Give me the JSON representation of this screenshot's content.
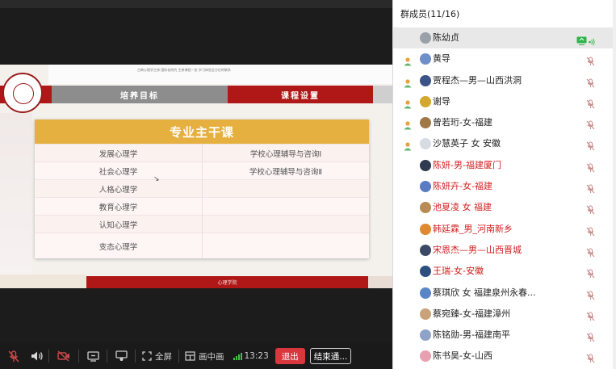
{
  "slide": {
    "header_small_text": "古典心理学主修   国际化研究   主修课程一览   学习体验全方位的联系",
    "tab_left": "培养目标",
    "tab_right": "课程设置",
    "table_title": "专业主干课",
    "courses": [
      [
        "发展心理学",
        "学校心理辅导与咨询Ⅰ"
      ],
      [
        "社会心理学",
        "学校心理辅导与咨询Ⅱ"
      ],
      [
        "人格心理学",
        ""
      ],
      [
        "教育心理学",
        ""
      ],
      [
        "认知心理学",
        ""
      ],
      [
        "变态心理学",
        ""
      ]
    ],
    "footer_text": "心理学院"
  },
  "toolbar": {
    "fullscreen_label": "全屏",
    "pip_label": "画中画",
    "time": "13:23",
    "exit_label": "退出",
    "end_label": "结束通..."
  },
  "panel": {
    "title": "群成员(11/16)",
    "members": [
      {
        "name": "陈幼贞",
        "role": false,
        "highlight": false,
        "selected": true,
        "sharing": true,
        "avatar": "#9aa0a8"
      },
      {
        "name": "黄导",
        "role": true,
        "highlight": false,
        "selected": false,
        "sharing": false,
        "avatar": "#6f8fc9"
      },
      {
        "name": "贾程杰—男—山西洪洞",
        "role": true,
        "highlight": false,
        "selected": false,
        "sharing": false,
        "avatar": "#3b5487"
      },
      {
        "name": "谢导",
        "role": true,
        "highlight": false,
        "selected": false,
        "sharing": false,
        "avatar": "#d4a82e"
      },
      {
        "name": "曾若珩-女-福建",
        "role": true,
        "highlight": false,
        "selected": false,
        "sharing": false,
        "avatar": "#a07848"
      },
      {
        "name": "沙慧英子 女 安徽",
        "role": true,
        "highlight": false,
        "selected": false,
        "sharing": false,
        "avatar": "#d7dbe3"
      },
      {
        "name": "陈妍-男-福建厦门",
        "role": false,
        "highlight": true,
        "selected": false,
        "sharing": false,
        "avatar": "#2e3a4f"
      },
      {
        "name": "陈妍卉-女-福建",
        "role": false,
        "highlight": true,
        "selected": false,
        "sharing": false,
        "avatar": "#5b7cc4"
      },
      {
        "name": "池夏凌 女 福建",
        "role": false,
        "highlight": true,
        "selected": false,
        "sharing": false,
        "avatar": "#b88a55"
      },
      {
        "name": "韩延霖_男_河南新乡",
        "role": false,
        "highlight": true,
        "selected": false,
        "sharing": false,
        "avatar": "#e08a2e"
      },
      {
        "name": "宋恩杰—男—山西晋城",
        "role": false,
        "highlight": true,
        "selected": false,
        "sharing": false,
        "avatar": "#3a4a66"
      },
      {
        "name": "王瑞-女-安徽",
        "role": false,
        "highlight": true,
        "selected": false,
        "sharing": false,
        "avatar": "#2f4f7f"
      },
      {
        "name": "蔡琪欣 女 福建泉州永春...",
        "role": false,
        "highlight": false,
        "selected": false,
        "sharing": false,
        "avatar": "#5a86c8"
      },
      {
        "name": "蔡宛臻-女-福建漳州",
        "role": false,
        "highlight": false,
        "selected": false,
        "sharing": false,
        "avatar": "#c9a27a"
      },
      {
        "name": "陈铭勋-男-福建南平",
        "role": false,
        "highlight": false,
        "selected": false,
        "sharing": false,
        "avatar": "#8fa3c8"
      },
      {
        "name": "陈书昊-女-山西",
        "role": false,
        "highlight": false,
        "selected": false,
        "sharing": false,
        "avatar": "#e8a0b0"
      }
    ]
  },
  "colors": {
    "accent_red": "#b01717",
    "table_gold": "#e5b040",
    "exit_red": "#d9363e",
    "signal_green": "#3fbf48",
    "share_green": "#2fb34a"
  }
}
